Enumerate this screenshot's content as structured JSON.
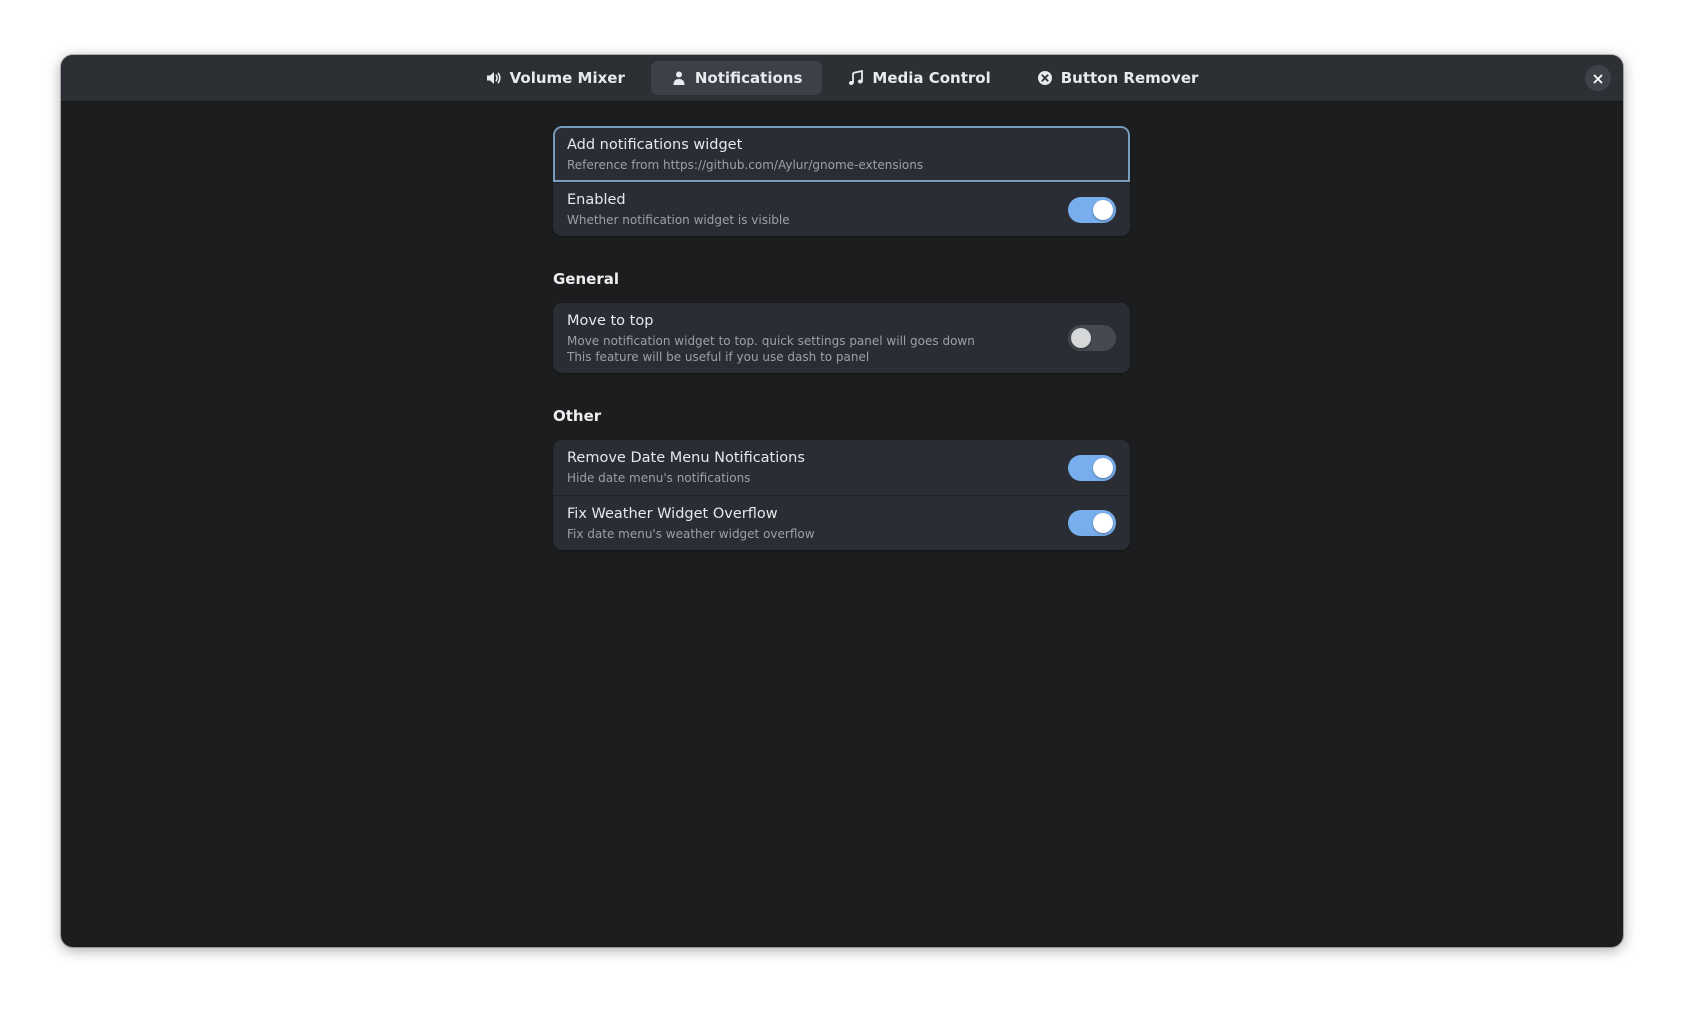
{
  "tabs": [
    {
      "label": "Volume Mixer",
      "icon": "speaker-icon",
      "active": false
    },
    {
      "label": "Notifications",
      "icon": "person-icon",
      "active": true
    },
    {
      "label": "Media Control",
      "icon": "music-note-icon",
      "active": false
    },
    {
      "label": "Button Remover",
      "icon": "circle-x-icon",
      "active": false
    }
  ],
  "colors": {
    "accent": "#78aeed",
    "background": "#1c1d1f",
    "card": "#2a2e34",
    "headerbar": "#2c2f34"
  },
  "main": {
    "add_widget": {
      "title": "Add notifications widget",
      "subtitle": "Reference from https://github.com/Aylur/gnome-extensions"
    },
    "enabled": {
      "title": "Enabled",
      "subtitle": "Whether notification widget is visible",
      "value": true
    }
  },
  "general": {
    "title": "General",
    "move_to_top": {
      "title": "Move to top",
      "subtitle_line1": "Move notification widget to top. quick settings panel will goes down",
      "subtitle_line2": "This feature will be useful if you use dash to panel",
      "value": false
    }
  },
  "other": {
    "title": "Other",
    "remove_date_menu": {
      "title": "Remove Date Menu Notifications",
      "subtitle": "Hide date menu's notifications",
      "value": true
    },
    "fix_weather": {
      "title": "Fix Weather Widget Overflow",
      "subtitle": "Fix date menu's weather widget overflow",
      "value": true
    }
  }
}
